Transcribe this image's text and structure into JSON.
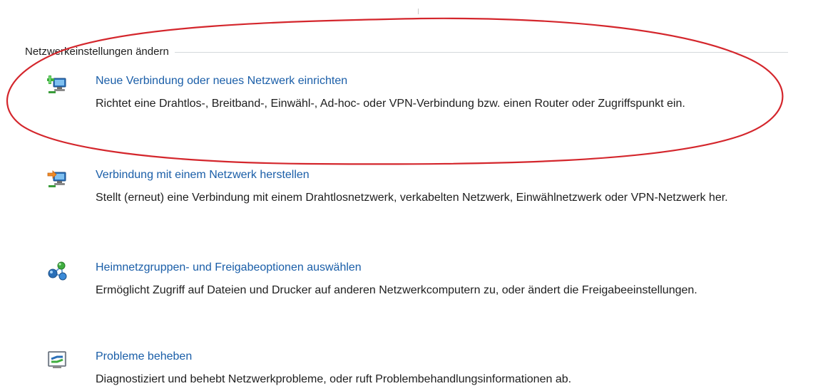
{
  "section": {
    "title": "Netzwerkeinstellungen ändern"
  },
  "tasks": [
    {
      "icon": "new-connection-icon",
      "link": "Neue Verbindung oder neues Netzwerk einrichten",
      "description": "Richtet eine Drahtlos-, Breitband-, Einwähl-, Ad-hoc- oder VPN-Verbindung bzw. einen Router oder Zugriffspunkt ein."
    },
    {
      "icon": "connect-network-icon",
      "link": "Verbindung mit einem Netzwerk herstellen",
      "description": "Stellt (erneut) eine Verbindung mit einem Drahtlosnetzwerk, verkabelten Netzwerk, Einwählnetzwerk oder VPN-Netzwerk her."
    },
    {
      "icon": "homegroup-icon",
      "link": "Heimnetzgruppen- und Freigabeoptionen auswählen",
      "description": "Ermöglicht Zugriff auf Dateien und Drucker auf anderen Netzwerkcomputern zu, oder ändert die Freigabeeinstellungen."
    },
    {
      "icon": "troubleshoot-icon",
      "link": "Probleme beheben",
      "description": "Diagnostiziert und behebt Netzwerkprobleme, oder ruft Problembehandlungsinformationen ab."
    }
  ],
  "colors": {
    "link": "#1a5ea8",
    "annotation": "#d4262c",
    "rule": "#d4d8dc"
  }
}
